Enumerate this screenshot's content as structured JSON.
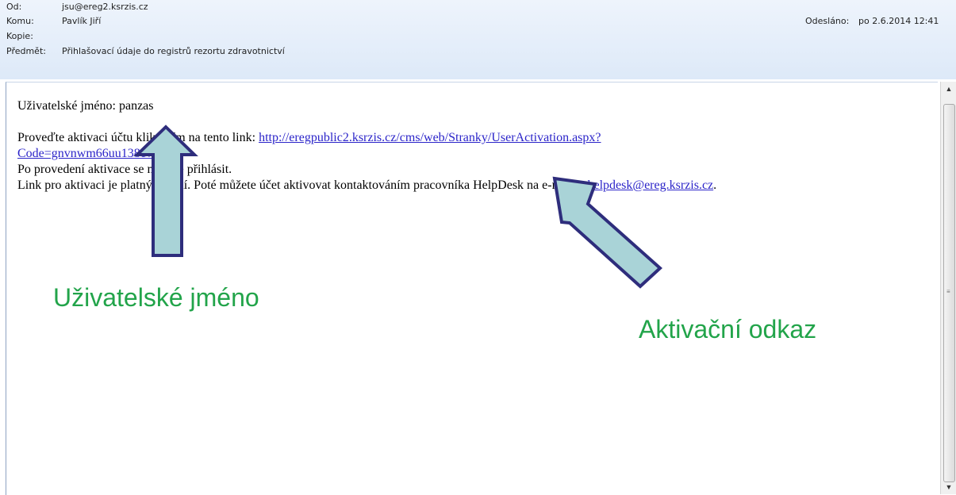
{
  "header": {
    "from_label": "Od:",
    "from_value": "jsu@ereg2.ksrzis.cz",
    "to_label": "Komu:",
    "to_value": "Pavlík Jiří",
    "cc_label": "Kopie:",
    "subject_label": "Předmět:",
    "subject_value": "Přihlašovací údaje do registrů rezortu zdravotnictví",
    "sent_label": "Odesláno:",
    "sent_value": "po 2.6.2014 12:41"
  },
  "body": {
    "username_line": "Uživatelské jméno: panzas",
    "activation_text": "Proveďte aktivaci účtu kliknutím na tento link: ",
    "activation_link_line1": "http://eregpublic2.ksrzis.cz/cms/web/Stranky/UserActivation.aspx?",
    "activation_link_line2": "Code=gnvnwm66uu138cv2rt",
    "after_activation": "Po provedení aktivace se můžete přihlásit.",
    "validity_text": "Link pro aktivaci je platný 30 dní. Poté můžete účet aktivovat kontaktováním pracovníka HelpDesk na e-mailu: ",
    "helpdesk_email": "helpdesk@ereg.ksrzis.cz",
    "validity_end": "."
  },
  "annotations": {
    "username_callout": "Uživatelské jméno",
    "activation_callout": "Aktivační odkaz",
    "callout_color": "#22a44a",
    "arrow_fill": "#a9d3d7",
    "arrow_stroke": "#2e2d7c"
  },
  "scrollbar": {
    "up_icon": "scroll-up-arrow-icon",
    "down_icon": "scroll-down-arrow-icon"
  }
}
